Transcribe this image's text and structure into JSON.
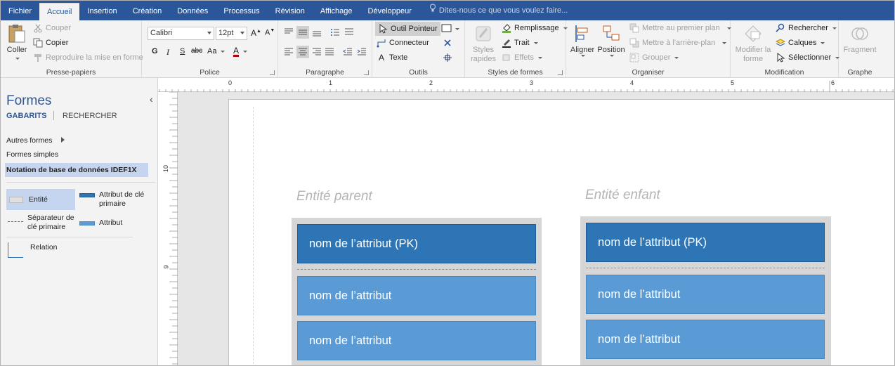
{
  "tabs": [
    "Fichier",
    "Accueil",
    "Insertion",
    "Création",
    "Données",
    "Processus",
    "Révision",
    "Affichage",
    "Développeur"
  ],
  "active_tab": "Accueil",
  "tell_me": "Dites-nous ce que vous voulez faire...",
  "ribbon": {
    "clipboard": {
      "paste": "Coller",
      "cut": "Couper",
      "copy": "Copier",
      "format_painter": "Reproduire la mise en forme",
      "label": "Presse-papiers"
    },
    "font": {
      "name": "Calibri",
      "size": "12pt",
      "label": "Police",
      "bold": "G",
      "italic": "I",
      "underline": "S",
      "strike": "abc",
      "font_size_btn": "Aa",
      "font_color": "A"
    },
    "paragraph": {
      "label": "Paragraphe"
    },
    "tools": {
      "pointer": "Outil Pointeur",
      "connector": "Connecteur",
      "text": "Texte",
      "label": "Outils"
    },
    "shape_styles": {
      "styles": "Styles rapides",
      "fill": "Remplissage",
      "line": "Trait",
      "effects": "Effets",
      "label": "Styles de formes"
    },
    "arrange": {
      "align": "Aligner",
      "position": "Position",
      "bring_front": "Mettre au premier plan",
      "send_back": "Mettre à l'arrière-plan",
      "group": "Grouper",
      "label": "Organiser"
    },
    "edit": {
      "change_shape": "Modifier la forme",
      "find": "Rechercher",
      "layers": "Calques",
      "select": "Sélectionner",
      "label": "Modification"
    },
    "graph": {
      "fragment": "Fragment",
      "label": "Graphe"
    }
  },
  "sidebar": {
    "title": "Formes",
    "tab_stencils": "GABARITS",
    "tab_search": "RECHERCHER",
    "more_shapes": "Autres formes",
    "basic_shapes": "Formes simples",
    "idef1x": "Notation de base de données IDEF1X",
    "stencils": {
      "entity": "Entité",
      "pk_attribute": "Attribut de clé primaire",
      "pk_separator": "Séparateur de clé primaire",
      "attribute": "Attribut",
      "relation": "Relation"
    }
  },
  "ruler": {
    "h_ticks": [
      "0",
      "1",
      "2",
      "3",
      "4",
      "5",
      "6"
    ],
    "v_ticks": [
      "10",
      "9"
    ]
  },
  "diagram": {
    "parent": {
      "title": "Entité parent",
      "pk": "nom de l’attribut (PK)",
      "attr1": "nom de l’attribut",
      "attr2": "nom de l’attribut"
    },
    "child": {
      "title": "Entité enfant",
      "pk": "nom de l’attribut (PK)",
      "attr1": "nom de l’attribut",
      "attr2": "nom de l’attribut"
    }
  },
  "colors": {
    "accent": "#2b579a",
    "pk": "#2e75b6",
    "attr": "#5b9bd5",
    "separator": "#70ad47"
  }
}
